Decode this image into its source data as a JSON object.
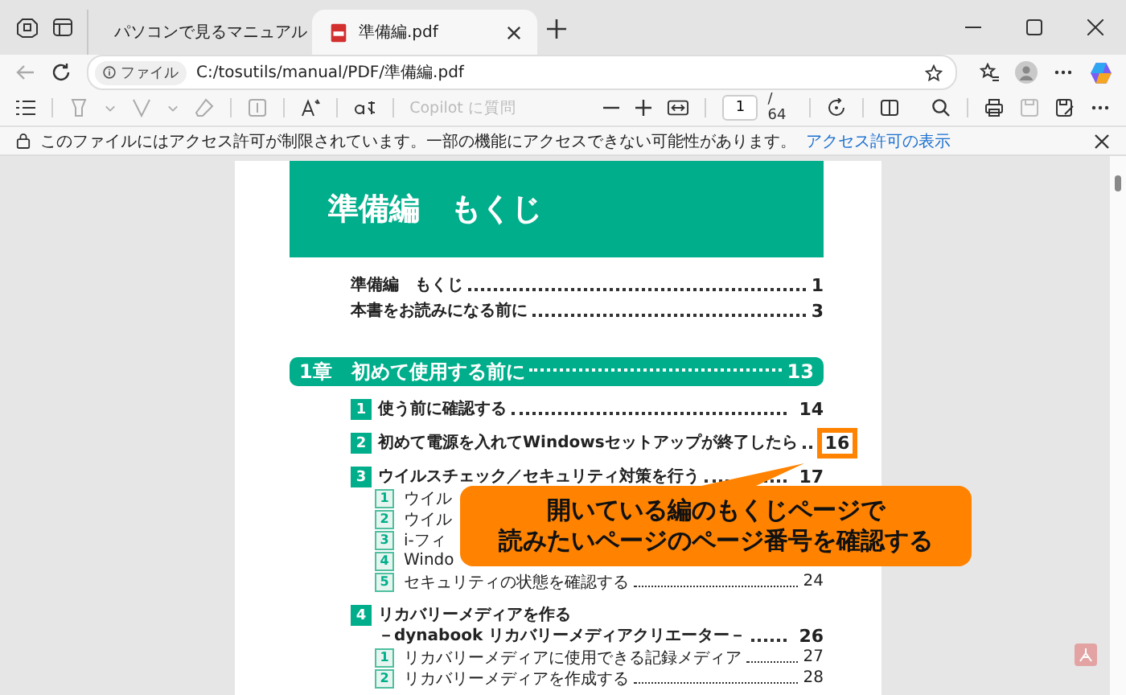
{
  "browser": {
    "tabs": [
      {
        "label": "パソコンで見るマニュアル",
        "selected": false,
        "kind": "web"
      },
      {
        "label": "準備編.pdf",
        "selected": true,
        "kind": "pdf"
      }
    ],
    "address": {
      "chip": "ファイル",
      "url": "C:/tosutils/manual/PDF/準備編.pdf"
    }
  },
  "pdf_toolbar": {
    "copilot_placeholder": "Copilot に質問",
    "page": "1",
    "total": "/ 64"
  },
  "info_bar": {
    "message": "このファイルにはアクセス許可が制限されています。一部の機能にアクセスできない可能性があります。",
    "link": "アクセス許可の表示"
  },
  "document": {
    "title": "準備編　もくじ",
    "entries": [
      {
        "text": "準備編　もくじ",
        "page": "1"
      },
      {
        "text": "本書をお読みになる前に",
        "page": "3"
      }
    ],
    "chapter": {
      "number": "1章",
      "title": "初めて使用する前に",
      "page": "13"
    },
    "sections": [
      {
        "number": "1",
        "lines": [
          "使う前に確認する"
        ],
        "page": "14",
        "highlighted": false
      },
      {
        "number": "2",
        "lines": [
          "初めて電源を入れてWindowsセットアップが終了したら"
        ],
        "page": "16",
        "highlighted": true
      },
      {
        "number": "3",
        "lines": [
          "ウイルスチェック／セキュリティ対策を行う"
        ],
        "page": "17",
        "highlighted": false,
        "subs": [
          {
            "number": "1",
            "text": "ウイル"
          },
          {
            "number": "2",
            "text": "ウイル"
          },
          {
            "number": "3",
            "text": "i-フィ"
          },
          {
            "number": "4",
            "text": "Windo"
          },
          {
            "number": "5",
            "text": "セキュリティの状態を確認する",
            "page": "24"
          }
        ]
      },
      {
        "number": "4",
        "lines": [
          "リカバリーメディアを作る",
          "－dynabook リカバリーメディアクリエーター－"
        ],
        "page": "26",
        "highlighted": false,
        "subs": [
          {
            "number": "1",
            "text": "リカバリーメディアに使用できる記録メディア",
            "page": "27"
          },
          {
            "number": "2",
            "text": "リカバリーメディアを作成する",
            "page": "28"
          }
        ]
      }
    ]
  },
  "callout": {
    "lines": [
      "開いている編のもくじページで",
      "読みたいページのページ番号を確認する"
    ]
  }
}
